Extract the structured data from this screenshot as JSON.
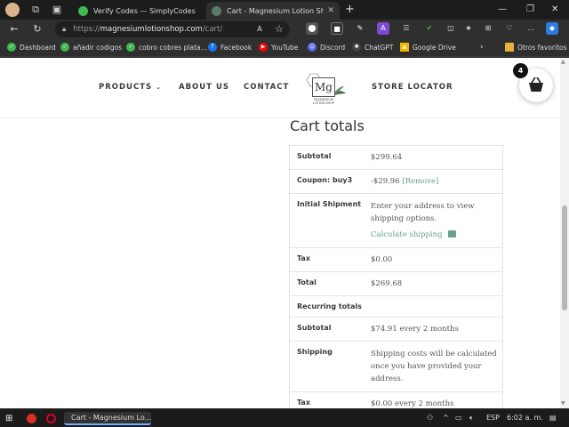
{
  "browser": {
    "tabs": [
      {
        "title": "Verify Codes — SimplyCodes",
        "active": false,
        "color": "#3fb950"
      },
      {
        "title": "Cart - Magnesium Lotion Shop",
        "active": true,
        "color": "#5a7a6a"
      }
    ],
    "new_tab_symbol": "+",
    "window_controls": {
      "minimize": "—",
      "restore": "❐",
      "close": "✕"
    },
    "address": {
      "scheme": "https://",
      "host": "magnesiumlotionshop.com",
      "path": "/cart/"
    },
    "bookmarks": [
      {
        "label": "Dashboard",
        "color": "#3fb950"
      },
      {
        "label": "añadir codigos",
        "color": "#3fb950"
      },
      {
        "label": "cobro cobres plata...",
        "color": "#3fb950"
      },
      {
        "label": "Facebook",
        "color": "#1877f2"
      },
      {
        "label": "YouTube",
        "color": "#ff0000"
      },
      {
        "label": "Discord",
        "color": "#5865f2"
      },
      {
        "label": "ChatGPT",
        "color": "#444444"
      },
      {
        "label": "Google Drive",
        "color": "#f4b400"
      }
    ],
    "bookmarks_other": "Otros favoritos"
  },
  "site": {
    "nav": {
      "products": "PRODUCTS",
      "about": "ABOUT US",
      "contact": "CONTACT",
      "store_locator": "STORE LOCATOR"
    },
    "logo": {
      "mark": "Mg",
      "tagline": "MAGNESIUM LOTION SHOP"
    },
    "cart_count": "4"
  },
  "cart_totals": {
    "title": "Cart totals",
    "rows": {
      "subtotal": {
        "label": "Subtotal",
        "value": "$299.64"
      },
      "coupon": {
        "label": "Coupon: buy3",
        "value": "-$29.96",
        "remove": "[Remove]"
      },
      "shipment": {
        "label": "Initial Shipment",
        "value": "Enter your address to view shipping options.",
        "link": "Calculate shipping"
      },
      "tax": {
        "label": "Tax",
        "value": "$0.00"
      },
      "total": {
        "label": "Total",
        "value": "$269.68"
      },
      "recurring": {
        "label": "Recurring totals"
      },
      "r_subtotal": {
        "label": "Subtotal",
        "value": "$74.91 every 2 months"
      },
      "r_shipping": {
        "label": "Shipping",
        "value": "Shipping costs will be calculated once you have provided your address."
      },
      "r_tax": {
        "label": "Tax",
        "value": "$0.00 every 2 months"
      }
    }
  },
  "taskbar": {
    "active_app": "Cart - Magnesium Lo...",
    "language": "ESP",
    "time": "6:02 a. m."
  }
}
